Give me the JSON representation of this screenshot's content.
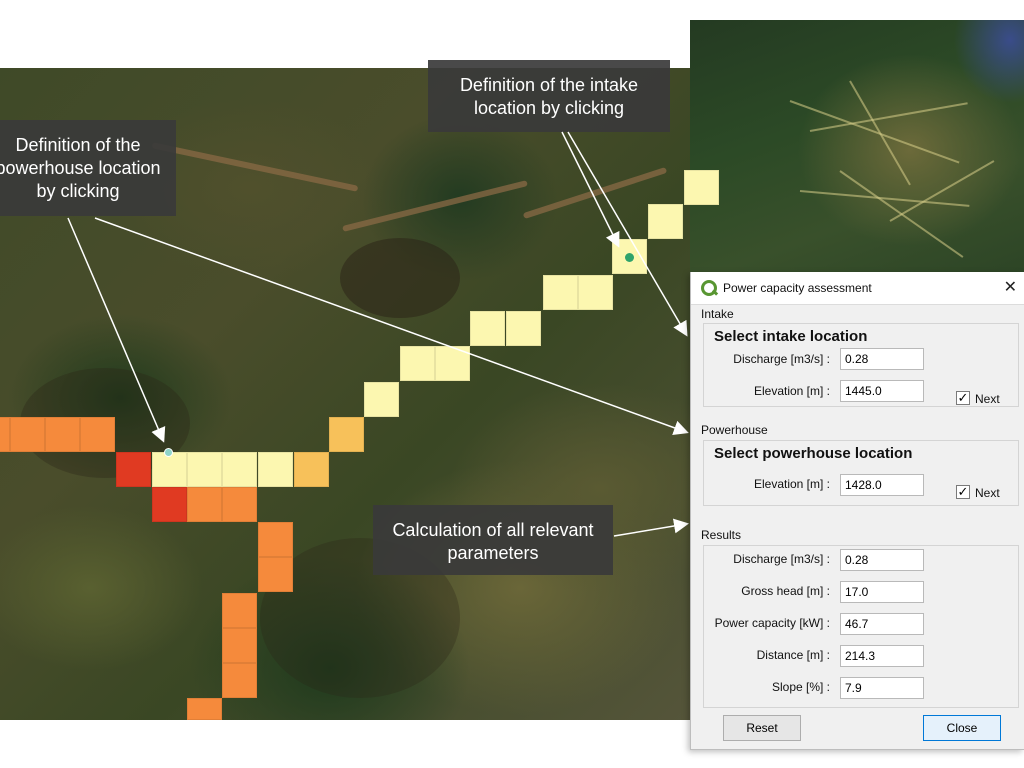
{
  "callouts": {
    "powerhouse": "Definition of the powerhouse location by clicking",
    "intake": "Definition of the intake location by clicking",
    "calc": "Calculation of all relevant parameters"
  },
  "dialog": {
    "title": "Power capacity assessment",
    "close_glyph": "✕",
    "intake": {
      "section": "Intake",
      "heading": "Select intake location",
      "discharge_label": "Discharge [m3/s] :",
      "discharge_value": "0.28",
      "elevation_label": "Elevation [m] :",
      "elevation_value": "1445.0",
      "next_label": "Next",
      "next_checked": "✓"
    },
    "powerhouse": {
      "section": "Powerhouse",
      "heading": "Select powerhouse location",
      "elevation_label": "Elevation [m] :",
      "elevation_value": "1428.0",
      "next_label": "Next",
      "next_checked": "✓"
    },
    "results": {
      "section": "Results",
      "discharge_label": "Discharge [m3/s] :",
      "discharge_value": "0.28",
      "gross_head_label": "Gross head [m] :",
      "gross_head_value": "17.0",
      "power_label": "Power capacity [kW] :",
      "power_value": "46.7",
      "distance_label": "Distance [m] :",
      "distance_value": "214.3",
      "slope_label": "Slope [%] :",
      "slope_value": "7.9"
    },
    "buttons": {
      "reset": "Reset",
      "close": "Close"
    }
  },
  "colors": {
    "cell_pale": "#fcf7b0",
    "cell_light_orange": "#f7c15a",
    "cell_orange": "#f58a3c",
    "cell_red": "#e03a22",
    "intake_point": "#2fa36b",
    "powerhouse_point": "#8fd3c8",
    "qgis_green": "#589632"
  }
}
